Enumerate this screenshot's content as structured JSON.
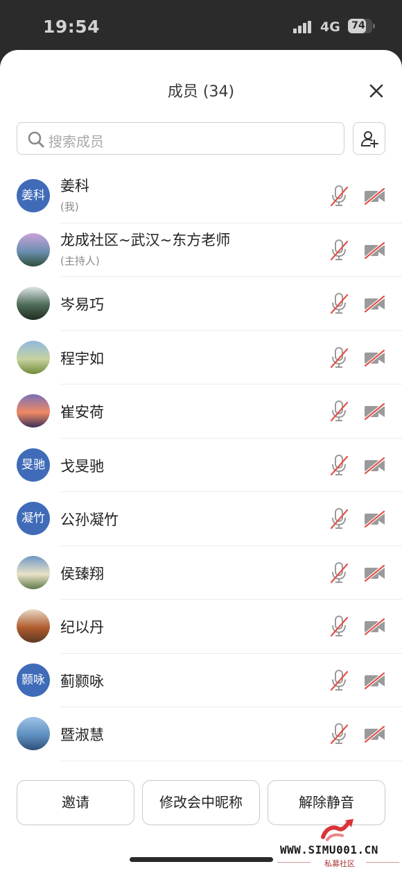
{
  "status": {
    "time": "19:54",
    "network": "4G",
    "battery": "74",
    "battery_level": 0.74
  },
  "sheet": {
    "title": "成员 (34)",
    "search_placeholder": "搜索成员"
  },
  "members": [
    {
      "name": "姜科",
      "role": "(我)",
      "avatar_text": "姜科",
      "avatar_kind": "text"
    },
    {
      "name": "龙成社区~武汉~东方老师",
      "role": "(主持人)",
      "avatar_kind": "photo",
      "palette": [
        "#c9a3d9",
        "#6b8fb0",
        "#2f4f3a"
      ]
    },
    {
      "name": "岑易巧",
      "role": "",
      "avatar_kind": "photo",
      "palette": [
        "#dfe7e9",
        "#4e6b57",
        "#1f2c22"
      ]
    },
    {
      "name": "程宇如",
      "role": "",
      "avatar_kind": "photo",
      "palette": [
        "#8fb9df",
        "#c8d3a0",
        "#6f8a3a"
      ]
    },
    {
      "name": "崔安荷",
      "role": "",
      "avatar_kind": "photo",
      "palette": [
        "#7a6fb6",
        "#f08a63",
        "#3a2f5a"
      ]
    },
    {
      "name": "戈旻驰",
      "role": "",
      "avatar_text": "旻驰",
      "avatar_kind": "text"
    },
    {
      "name": "公孙凝竹",
      "role": "",
      "avatar_text": "凝竹",
      "avatar_kind": "text"
    },
    {
      "name": "侯臻翔",
      "role": "",
      "avatar_kind": "photo",
      "palette": [
        "#6f98c6",
        "#e9e2c6",
        "#5e7a4a"
      ]
    },
    {
      "name": "纪以丹",
      "role": "",
      "avatar_kind": "photo",
      "palette": [
        "#e6d8c4",
        "#b05c2d",
        "#5a3a22"
      ]
    },
    {
      "name": "蓟颢咏",
      "role": "",
      "avatar_text": "颢咏",
      "avatar_kind": "text"
    },
    {
      "name": "暨淑慧",
      "role": "",
      "avatar_kind": "photo",
      "palette": [
        "#9ec3e6",
        "#5e8fc0",
        "#2f4f78"
      ]
    }
  ],
  "buttons": {
    "invite": "邀请",
    "rename": "修改会中昵称",
    "unmute": "解除静音"
  },
  "watermark": {
    "url": "WWW.SIMU001.CN",
    "sub": "私募社区"
  },
  "colors": {
    "avatar_blue": "#3f6bb8",
    "muted_slash": "#e0524a",
    "icon_gray": "#9a9a9a"
  }
}
